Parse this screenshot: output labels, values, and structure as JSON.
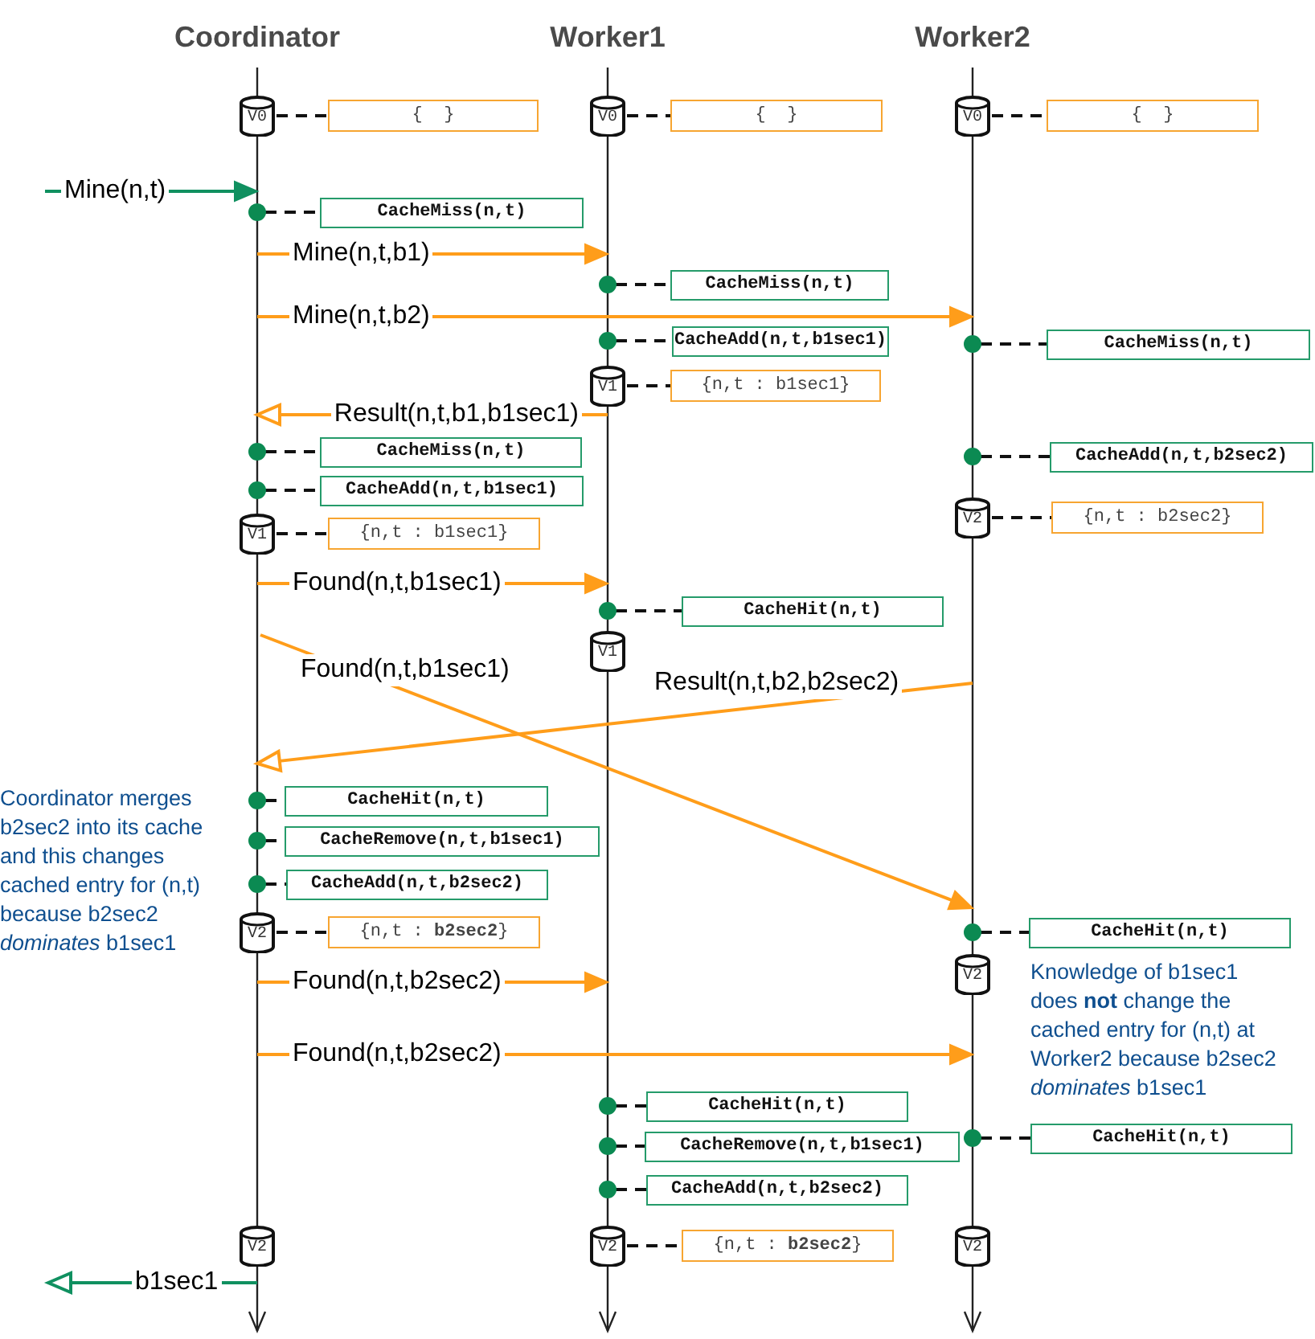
{
  "participants": [
    {
      "name": "Coordinator"
    },
    {
      "name": "Worker1"
    },
    {
      "name": "Worker2"
    }
  ],
  "events": [
    {
      "kind": "version",
      "label": "V0"
    },
    {
      "kind": "state",
      "text": "{  }"
    },
    {
      "kind": "version",
      "label": "V0"
    },
    {
      "kind": "state",
      "text": "{  }"
    },
    {
      "kind": "version",
      "label": "V0"
    },
    {
      "kind": "state",
      "text": "{  }"
    },
    {
      "kind": "external_call",
      "label": "Mine(n,t)"
    },
    {
      "kind": "cache",
      "label": "CacheMiss(n,t)"
    },
    {
      "kind": "call",
      "label": "Mine(n,t,b1)"
    },
    {
      "kind": "cache",
      "label": "CacheMiss(n,t)"
    },
    {
      "kind": "call",
      "label": "Mine(n,t,b2)"
    },
    {
      "kind": "cache",
      "label": "CacheAdd(n,t,b1sec1)"
    },
    {
      "kind": "cache",
      "label": "CacheMiss(n,t)"
    },
    {
      "kind": "version",
      "label": "V1"
    },
    {
      "kind": "state",
      "text": "{n,t : b1sec1}"
    },
    {
      "kind": "reply",
      "label": "Result(n,t,b1,b1sec1)"
    },
    {
      "kind": "cache",
      "label": "CacheMiss(n,t)"
    },
    {
      "kind": "cache",
      "label": "CacheAdd(n,t,b2sec2)"
    },
    {
      "kind": "cache",
      "label": "CacheAdd(n,t,b1sec1)"
    },
    {
      "kind": "version",
      "label": "V2"
    },
    {
      "kind": "state",
      "text": "{n,t : b2sec2}"
    },
    {
      "kind": "version",
      "label": "V1"
    },
    {
      "kind": "state",
      "text": "{n,t : b1sec1}"
    },
    {
      "kind": "call",
      "label": "Found(n,t,b1sec1)"
    },
    {
      "kind": "cache",
      "label": "CacheHit(n,t)"
    },
    {
      "kind": "version",
      "label": "V1"
    },
    {
      "kind": "call",
      "label": "Found(n,t,b1sec1)"
    },
    {
      "kind": "reply",
      "label": "Result(n,t,b2,b2sec2)"
    },
    {
      "kind": "note",
      "text": "Coordinator merges\nb2sec2 into its cache\nand this changes\ncached entry for (n,t)\nbecause b2sec2\n*dominates* b1sec1"
    },
    {
      "kind": "cache",
      "label": "CacheHit(n,t)"
    },
    {
      "kind": "cache",
      "label": "CacheRemove(n,t,b1sec1)"
    },
    {
      "kind": "cache",
      "label": "CacheAdd(n,t,b2sec2)"
    },
    {
      "kind": "version",
      "label": "V2"
    },
    {
      "kind": "state",
      "text": "{n,t : **b2sec2**}"
    },
    {
      "kind": "cache",
      "label": "CacheHit(n,t)"
    },
    {
      "kind": "call",
      "label": "Found(n,t,b2sec2)"
    },
    {
      "kind": "version",
      "label": "V2"
    },
    {
      "kind": "call",
      "label": "Found(n,t,b2sec2)"
    },
    {
      "kind": "note",
      "text": "Knowledge of b1sec1\ndoes **not** change the\ncached entry for (n,t) at\nWorker2 because b2sec2\n*dominates* b1sec1"
    },
    {
      "kind": "cache",
      "label": "CacheHit(n,t)"
    },
    {
      "kind": "cache",
      "label": "CacheHit(n,t)"
    },
    {
      "kind": "cache",
      "label": "CacheRemove(n,t,b1sec1)"
    },
    {
      "kind": "cache",
      "label": "CacheAdd(n,t,b2sec2)"
    },
    {
      "kind": "version",
      "label": "V2"
    },
    {
      "kind": "version",
      "label": "V2"
    },
    {
      "kind": "state",
      "text": "{n,t : **b2sec2**}"
    },
    {
      "kind": "version",
      "label": "V2"
    },
    {
      "kind": "external_reply",
      "label": "b1sec1"
    }
  ]
}
